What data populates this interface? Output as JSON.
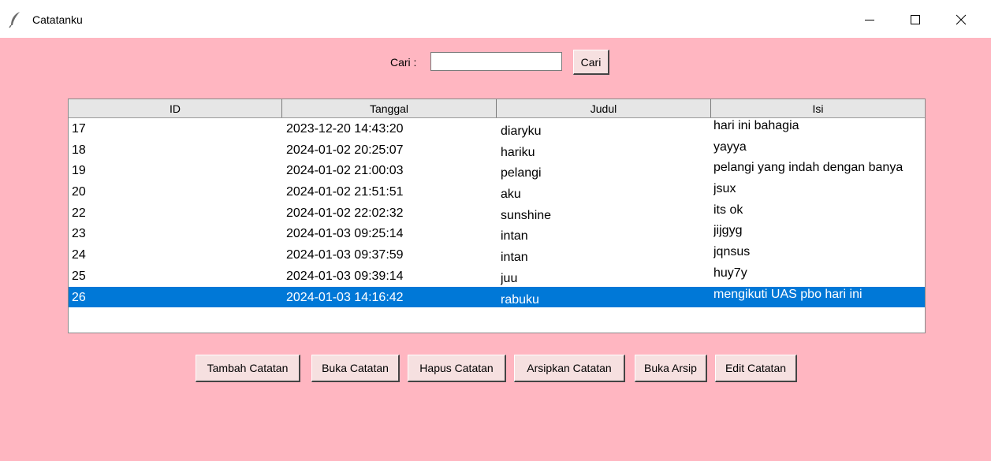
{
  "window": {
    "title": "Catatanku",
    "icon": "feather-icon",
    "background_color": "#ffb6c1"
  },
  "search": {
    "label": "Cari :",
    "value": "",
    "button_label": "Cari"
  },
  "table": {
    "columns": [
      "ID",
      "Tanggal",
      "Judul",
      "Isi"
    ],
    "rows": [
      [
        "17",
        "2023-12-20 14:43:20",
        "diaryku",
        "hari ini bahagia"
      ],
      [
        "18",
        "2024-01-02 20:25:07",
        "hariku",
        "yayya"
      ],
      [
        "19",
        "2024-01-02 21:00:03",
        "pelangi",
        "pelangi yang indah dengan banya"
      ],
      [
        "20",
        "2024-01-02 21:51:51",
        "aku",
        "jsux"
      ],
      [
        "22",
        "2024-01-02 22:02:32",
        "sunshine",
        "its ok"
      ],
      [
        "23",
        "2024-01-03 09:25:14",
        "intan",
        "jijgyg"
      ],
      [
        "24",
        "2024-01-03 09:37:59",
        "intan",
        "jqnsus"
      ],
      [
        "25",
        "2024-01-03 09:39:14",
        "juu",
        "huy7y"
      ],
      [
        "26",
        "2024-01-03 14:16:42",
        "rabuku",
        "mengikuti UAS pbo hari ini"
      ]
    ],
    "selected_row_index": 8,
    "selection_color": "#0078d7"
  },
  "actions": {
    "tambah": "Tambah Catatan",
    "buka": "Buka Catatan",
    "hapus": "Hapus Catatan",
    "arsipkan": "Arsipkan Catatan",
    "buka_arsip": "Buka Arsip",
    "edit": "Edit Catatan"
  }
}
